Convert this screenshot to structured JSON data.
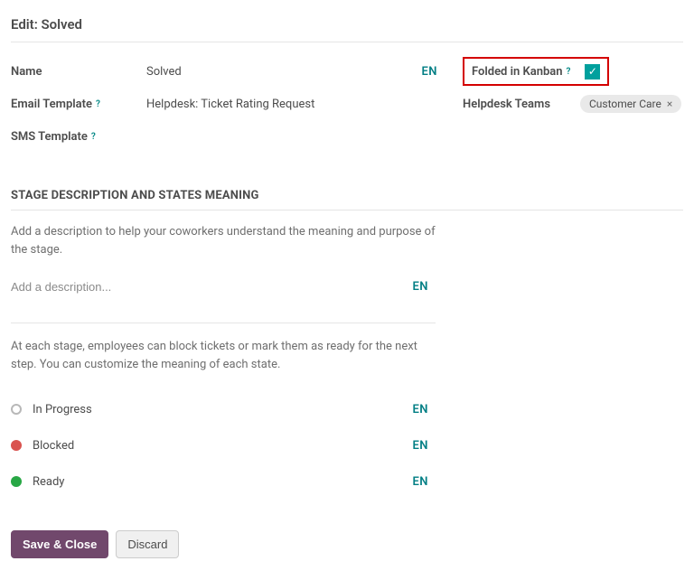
{
  "title": "Edit: Solved",
  "lang_badge": "EN",
  "left": {
    "name_label": "Name",
    "name_value": "Solved",
    "email_template_label": "Email Template",
    "email_template_value": "Helpdesk: Ticket Rating Request",
    "sms_template_label": "SMS Template"
  },
  "right": {
    "folded_label": "Folded in Kanban",
    "folded_checked": true,
    "teams_label": "Helpdesk Teams",
    "team_tag": "Customer Care"
  },
  "section": {
    "title": "STAGE DESCRIPTION AND STATES MEANING",
    "helper": "Add a description to help your coworkers understand the meaning and purpose of the stage.",
    "desc_placeholder": "Add a description...",
    "states_helper": "At each stage, employees can block tickets or mark them as ready for the next step. You can customize the meaning of each state.",
    "state_in_progress": "In Progress",
    "state_blocked": "Blocked",
    "state_ready": "Ready"
  },
  "buttons": {
    "save": "Save & Close",
    "discard": "Discard"
  },
  "help_glyph": "?",
  "tag_close_glyph": "×",
  "check_glyph": "✓"
}
